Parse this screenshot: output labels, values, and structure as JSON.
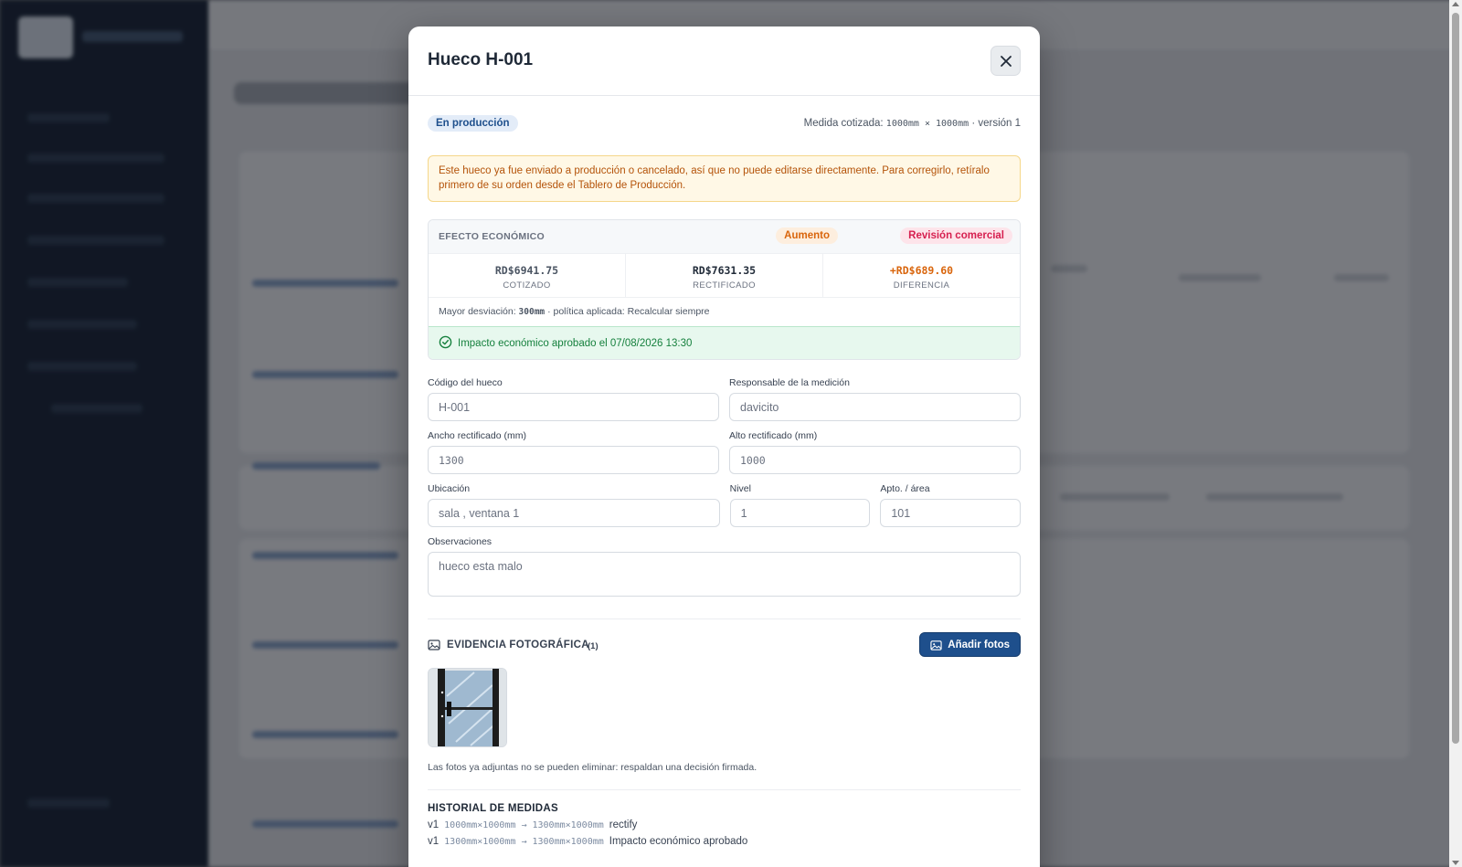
{
  "modal": {
    "title": "Hueco H-001",
    "status": "En producción",
    "medida_prefix": "Medida cotizada:",
    "medida_value": "1000mm × 1000mm",
    "medida_suffix": "· versión 1",
    "warning": "Este hueco ya fue enviado a producción o cancelado, así que no puede editarse directamente. Para corregirlo, retíralo primero de su orden desde el Tablero de Producción."
  },
  "effect": {
    "title": "EFECTO ECONÓMICO",
    "tag_aumento": "Aumento",
    "tag_revision": "Revisión comercial",
    "cotizado_value": "RD$6941.75",
    "cotizado_label": "COTIZADO",
    "rectificado_value": "RD$7631.35",
    "rectificado_label": "RECTIFICADO",
    "diferencia_value": "+RD$689.60",
    "diferencia_label": "DIFERENCIA",
    "note_prefix": "Mayor desviación:",
    "note_value": "300mm",
    "note_suffix": "· política aplicada: Recalcular siempre",
    "approved": "Impacto económico aprobado el 07/08/2026 13:30"
  },
  "form": {
    "codigo_label": "Código del hueco",
    "codigo_value": "H-001",
    "responsable_label": "Responsable de la medición",
    "responsable_value": "davicito",
    "ancho_label": "Ancho rectificado (mm)",
    "ancho_value": "1300",
    "alto_label": "Alto rectificado (mm)",
    "alto_value": "1000",
    "ubicacion_label": "Ubicación",
    "ubicacion_value": "sala , ventana 1",
    "nivel_label": "Nivel",
    "nivel_value": "1",
    "apto_label": "Apto. / área",
    "apto_value": "101",
    "observaciones_label": "Observaciones",
    "observaciones_value": "hueco  esta malo"
  },
  "photos": {
    "title": "EVIDENCIA FOTOGRÁFICA",
    "count": "(1)",
    "add_button": "Añadir fotos",
    "note": "Las fotos ya adjuntas no se pueden eliminar: respaldan una decisión firmada."
  },
  "history": {
    "title": "HISTORIAL DE MEDIDAS",
    "rows": [
      {
        "version": "v1",
        "change": "1000mm×1000mm → 1300mm×1000mm",
        "reason": "rectify"
      },
      {
        "version": "v1",
        "change": "1300mm×1000mm → 1300mm×1000mm",
        "reason": "Impacto económico aprobado"
      }
    ]
  },
  "colors": {
    "primary": "#1e4f8c",
    "orange": "#d9650c",
    "pink": "#d61f4f",
    "green": "#15803d"
  }
}
